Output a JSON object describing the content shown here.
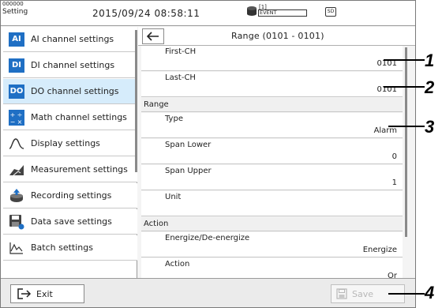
{
  "status": {
    "id": "000000",
    "mode": "Setting",
    "datetime": "2015/09/24 08:58:11",
    "event_count": "[1]",
    "event_label": "EVENT",
    "sd_label": "SD"
  },
  "menu": {
    "items": [
      {
        "label": "AI channel settings",
        "icon": "ai-badge-icon",
        "badge": "AI",
        "active": false
      },
      {
        "label": "DI channel settings",
        "icon": "di-badge-icon",
        "badge": "DI",
        "active": false
      },
      {
        "label": "DO channel settings",
        "icon": "do-badge-icon",
        "badge": "DO",
        "active": true
      },
      {
        "label": "Math channel settings",
        "icon": "math-icon",
        "badge": "+÷\n−×",
        "active": false
      },
      {
        "label": "Display settings",
        "icon": "display-wave-icon",
        "active": false
      },
      {
        "label": "Measurement settings",
        "icon": "measurement-icon",
        "active": false
      },
      {
        "label": "Recording settings",
        "icon": "recording-icon",
        "active": false
      },
      {
        "label": "Data save settings",
        "icon": "data-save-icon",
        "active": false
      },
      {
        "label": "Batch settings",
        "icon": "batch-icon",
        "active": false
      }
    ]
  },
  "panel": {
    "title": "Range (0101 - 0101)",
    "rows": {
      "first_ch": {
        "label": "First-CH",
        "value": "0101"
      },
      "last_ch": {
        "label": "Last-CH",
        "value": "0101"
      },
      "range_section": "Range",
      "type": {
        "label": "Type",
        "value": "Alarm"
      },
      "span_lower": {
        "label": "Span Lower",
        "value": "0"
      },
      "span_upper": {
        "label": "Span Upper",
        "value": "1"
      },
      "unit": {
        "label": "Unit",
        "value": ""
      },
      "action_section": "Action",
      "energize": {
        "label": "Energize/De-energize",
        "value": "Energize"
      },
      "action": {
        "label": "Action",
        "value": "Or"
      }
    }
  },
  "bottom": {
    "exit_label": "Exit",
    "save_label": "Save"
  },
  "callouts": [
    "1",
    "2",
    "3",
    "4"
  ],
  "colors": {
    "accent_blue": "#1f6fc4",
    "active_row": "#d6ecfb",
    "disabled_text": "#b8b8b8"
  }
}
